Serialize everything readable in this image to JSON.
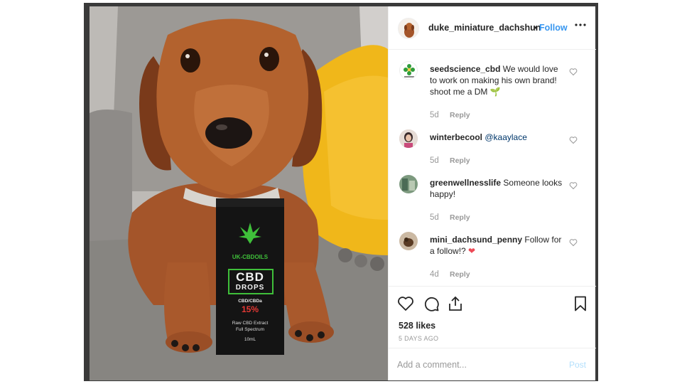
{
  "header": {
    "username": "duke_miniature_dachshun",
    "separator": "•",
    "follow_label": "Follow",
    "more_label": "•••",
    "avatar_icon": "dachshund-avatar"
  },
  "product_box": {
    "brand": "UK-CBDOILS",
    "line1": "CBD",
    "line2": "DROPS",
    "ratio": "CBD/CBDa",
    "percent": "15%",
    "desc1": "Raw CBD Extract",
    "desc2": "Full Spectrum",
    "volume": "10mL"
  },
  "comments": [
    {
      "username": "seedscience_cbd",
      "text": "We would love to work on making his own brand! shoot me a DM",
      "emoji": "🌱",
      "age": "5d",
      "reply": "Reply",
      "heart_icon": "heart-outline-icon"
    },
    {
      "username": "winterbecool",
      "text": "",
      "mention": "@kaaylace",
      "age": "5d",
      "reply": "Reply",
      "heart_icon": "heart-outline-icon"
    },
    {
      "username": "greenwellnesslife",
      "text": "Someone looks happy!",
      "age": "5d",
      "reply": "Reply",
      "heart_icon": "heart-outline-icon"
    },
    {
      "username": "mini_dachsund_penny",
      "text": "Follow for a follow!?",
      "emoji": "❤",
      "age": "4d",
      "reply": "Reply",
      "heart_icon": "heart-outline-icon"
    }
  ],
  "actions": {
    "icons": [
      "heart-icon",
      "comment-icon",
      "share-icon",
      "bookmark-icon"
    ],
    "likes": "528 likes",
    "time": "5 DAYS AGO"
  },
  "add_comment": {
    "placeholder": "Add a comment...",
    "post_label": "Post"
  },
  "colors": {
    "link_blue": "#3897f0",
    "post_disabled": "#b2dffc",
    "mention": "#00376b",
    "emoji_heart": "#ed4956"
  }
}
